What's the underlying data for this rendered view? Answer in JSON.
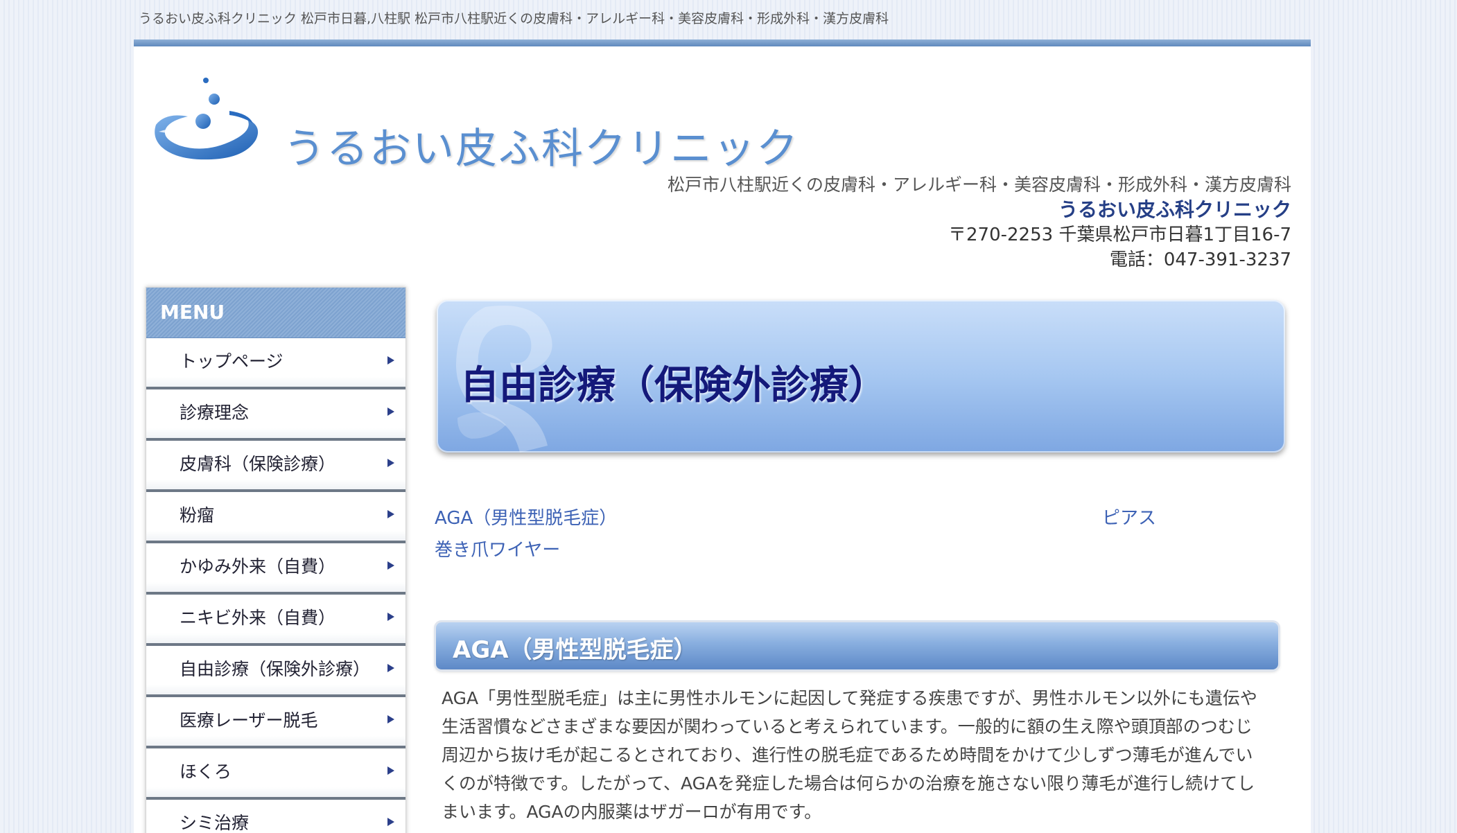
{
  "header_strip": "うるおい皮ふ科クリニック 松戸市日暮,八柱駅 松戸市八柱駅近くの皮膚科・アレルギー科・美容皮膚科・形成外科・漢方皮膚科",
  "logo": {
    "text": "うるおい皮ふ科クリニック",
    "accent": "#5a8fd0"
  },
  "clinic_info": {
    "description": "松戸市八柱駅近くの皮膚科・アレルギー科・美容皮膚科・形成外科・漢方皮膚科",
    "name": "うるおい皮ふ科クリニック",
    "address": "〒270-2253 千葉県松戸市日暮1丁目16-7",
    "phone": "電話：047-391-3237"
  },
  "sidebar": {
    "heading": "MENU",
    "items": [
      {
        "label": "トップページ"
      },
      {
        "label": "診療理念"
      },
      {
        "label": "皮膚科（保険診療）"
      },
      {
        "label": "粉瘤"
      },
      {
        "label": "かゆみ外来（自費）"
      },
      {
        "label": "ニキビ外来（自費）"
      },
      {
        "label": "自由診療（保険外診療）"
      },
      {
        "label": "医療レーザー脱毛"
      },
      {
        "label": "ほくろ"
      },
      {
        "label": "シミ治療"
      }
    ]
  },
  "main": {
    "page_title": "自由診療（保険外診療）",
    "links": [
      "AGA（男性型脱毛症）",
      "ピアス",
      "巻き爪ワイヤー"
    ],
    "section": {
      "title": "AGA（男性型脱毛症）",
      "lines": [
        "AGA「男性型脱毛症」は主に男性ホルモンに起因して発症する疾患ですが、男性ホルモン以外にも遺伝や",
        "生活習慣などさまざまな要因が関わっていると考えられています。一般的に額の生え際や頭頂部のつむじ",
        "周辺から抜け毛が起こるとされており、進行性の脱毛症であるため時間をかけて少しずつ薄毛が進んでい",
        "くのが特徴です。したがって、AGAを発症した場合は何らかの治療を施さない限り薄毛が進行し続けてし",
        "まいます。AGAの内服薬はザガーロが有用です。"
      ]
    }
  },
  "colors": {
    "title": "#14197a",
    "link": "#3d62b5",
    "clinic_name": "#253f86"
  }
}
